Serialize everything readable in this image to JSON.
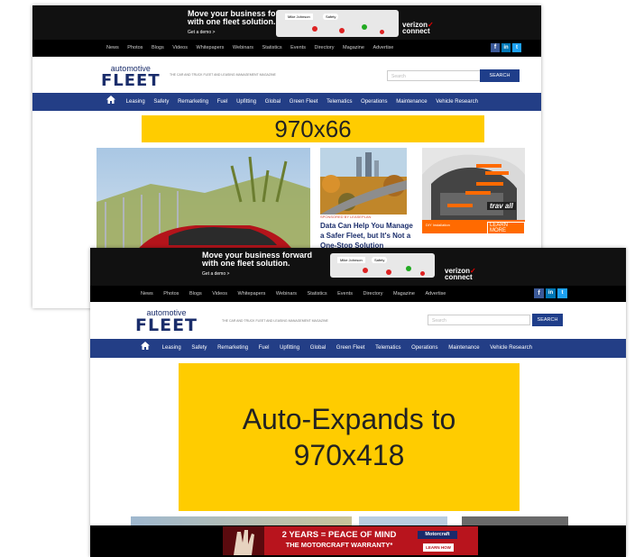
{
  "topad": {
    "headline_1": "Move your business forward",
    "headline_2": "with one fleet solution.",
    "cta": "Get a demo >",
    "phone_name": "Mike Johnson",
    "phone_chip": "Safety",
    "brand_1": "verizon",
    "brand_2": "connect"
  },
  "nav": {
    "items": [
      "News",
      "Photos",
      "Blogs",
      "Videos",
      "Whitepapers",
      "Webinars",
      "Statistics",
      "Events",
      "Directory",
      "Magazine",
      "Advertise"
    ],
    "social": [
      "f",
      "in",
      "t"
    ]
  },
  "header": {
    "logo_top": "automotive",
    "logo_main": "FLEET",
    "tagline": "THE CAR AND TRUCK FLEET AND LEASING MANAGEMENT MAGAZINE",
    "search_placeholder": "Search",
    "search_button": "SEARCH"
  },
  "menu": {
    "items": [
      "Leasing",
      "Safety",
      "Remarketing",
      "Fuel",
      "Upfitting",
      "Global",
      "Green Fleet",
      "Telematics",
      "Operations",
      "Maintenance",
      "Vehicle Research"
    ]
  },
  "ad_collapsed": "970x66",
  "ad_expanded_1": "Auto-Expands to",
  "ad_expanded_2": "970x418",
  "article": {
    "sponsor": "SPONSORED BY LEASEPLAN",
    "title_1": "Data Can Help You Manage",
    "title_2": "a Safer Fleet, but It's Not a",
    "title_3": "One-Stop Solution"
  },
  "sidead": {
    "brand": "trav all",
    "install": "DIY Installation",
    "cta": "LEARN MORE"
  },
  "bottomad": {
    "line_1": "2 YEARS = PEACE OF MIND",
    "line_2": "THE MOTORCRAFT WARRANTY",
    "brand": "Motorcraft",
    "cta": "LEARN HOW"
  },
  "colors": {
    "navy": "#233e86",
    "ad_yellow": "#ffcc00",
    "black_bar": "#000000"
  }
}
